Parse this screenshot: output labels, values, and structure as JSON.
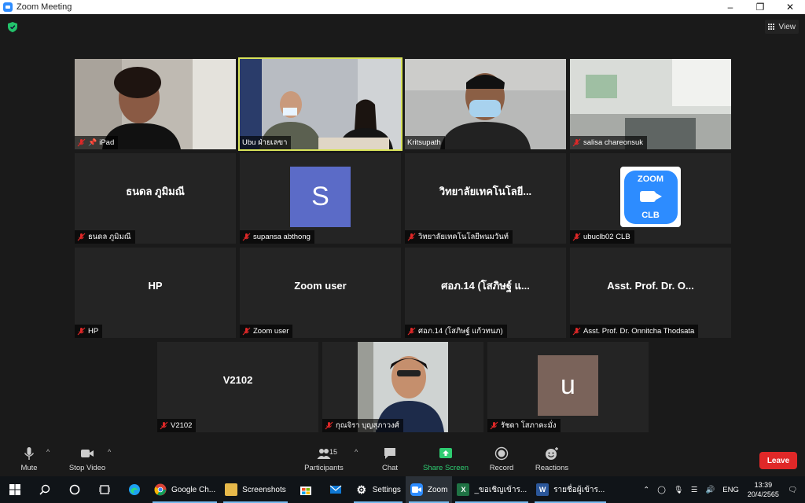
{
  "window": {
    "title": "Zoom Meeting"
  },
  "top": {
    "view_label": "View"
  },
  "participants": [
    {
      "id": "ipad",
      "label": "iPad",
      "type": "video"
    },
    {
      "id": "ubu",
      "label": "Ubu ฝ่ายเลขา",
      "type": "video",
      "active": true
    },
    {
      "id": "kritsupath",
      "label": "Kritsupath",
      "type": "video"
    },
    {
      "id": "salisa",
      "label": "salisa chareonsuk",
      "type": "video"
    },
    {
      "id": "thanadol",
      "big": "ธนดล ภูมิมณี",
      "label": "ธนดล ภูมิมณี"
    },
    {
      "id": "supansa",
      "avatar": "S",
      "label": "supansa abthong"
    },
    {
      "id": "college",
      "big": "วิทยาลัยเทคโนโลยี...",
      "label": "วิทยาลัยเทคโนโลยีพนมวันท์"
    },
    {
      "id": "ubuclb",
      "logo_top": "ZOOM",
      "logo_bottom": "CLB",
      "label": "ubuclb02 CLB"
    },
    {
      "id": "hp",
      "big": "HP",
      "label": "HP"
    },
    {
      "id": "zoomuser",
      "big": "Zoom user",
      "label": "Zoom user"
    },
    {
      "id": "sorpor",
      "big": "ศอภ.14 (โสภิษฐ์ แ...",
      "label": "ศอภ.14 (โสภิษฐ์ แก้วทนภ)"
    },
    {
      "id": "onnitcha",
      "big": "Asst. Prof. Dr. O...",
      "label": "Asst. Prof. Dr. Onnitcha Thodsata"
    },
    {
      "id": "v2102",
      "big": "V2102",
      "label": "V2102"
    },
    {
      "id": "kunjira",
      "label": "กุณจิรา บุญสุภาวงศ์",
      "type": "video"
    },
    {
      "id": "ratchada",
      "avatar": "u",
      "label": "รัชดา โสภาคะมั่ง"
    }
  ],
  "controls": {
    "mute": "Mute",
    "stop_video": "Stop Video",
    "participants": "Participants",
    "participants_count": "15",
    "chat": "Chat",
    "share_screen": "Share Screen",
    "record": "Record",
    "reactions": "Reactions",
    "leave": "Leave"
  },
  "taskbar": {
    "apps": [
      {
        "label": "Google Ch...",
        "icon": "chrome-icon"
      },
      {
        "label": "Screenshots",
        "icon": "folder-icon"
      },
      {
        "label": "Settings",
        "icon": "gear-icon"
      },
      {
        "label": "Zoom",
        "icon": "zoom-icon"
      },
      {
        "label": "_ขอเชิญเข้าร...",
        "icon": "excel-icon"
      },
      {
        "label": "รายชื่อผู้เข้าร...",
        "icon": "word-icon"
      }
    ],
    "language": "ENG",
    "time": "13:39",
    "date": "20/4/2565"
  },
  "colors": {
    "accent": "#2d8cff",
    "leave": "#e02828",
    "share": "#2ecc71",
    "active_border": "#d9e35a"
  }
}
